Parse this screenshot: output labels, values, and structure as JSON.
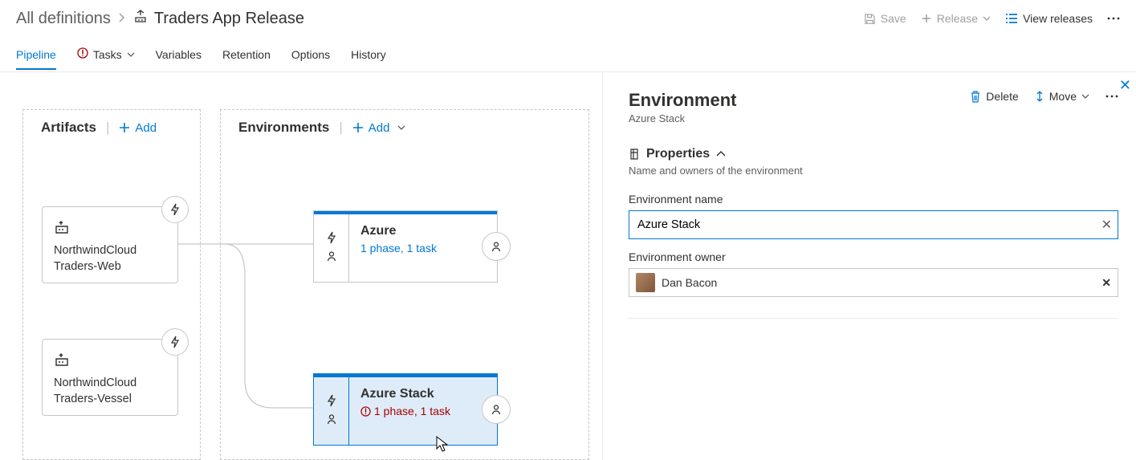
{
  "breadcrumb": {
    "root": "All definitions",
    "title": "Traders App Release"
  },
  "header_actions": {
    "save": "Save",
    "release": "Release",
    "view": "View releases"
  },
  "tabs": {
    "pipeline": "Pipeline",
    "tasks": "Tasks",
    "variables": "Variables",
    "retention": "Retention",
    "options": "Options",
    "history": "History"
  },
  "columns": {
    "artifacts_title": "Artifacts",
    "envs_title": "Environments",
    "add": "Add"
  },
  "artifacts": [
    {
      "name": "NorthwindCloud Traders-Web"
    },
    {
      "name": "NorthwindCloud Traders-Vessel"
    }
  ],
  "envs": [
    {
      "name": "Azure",
      "sub": "1 phase, 1 task",
      "error": false
    },
    {
      "name": "Azure Stack",
      "sub": "1 phase, 1 task",
      "error": true
    }
  ],
  "panel": {
    "heading": "Environment",
    "sub": "Azure Stack",
    "delete": "Delete",
    "move": "Move",
    "props_title": "Properties",
    "props_desc": "Name and owners of the environment",
    "name_label": "Environment name",
    "name_value": "Azure Stack",
    "owner_label": "Environment owner",
    "owner_name": "Dan Bacon"
  }
}
